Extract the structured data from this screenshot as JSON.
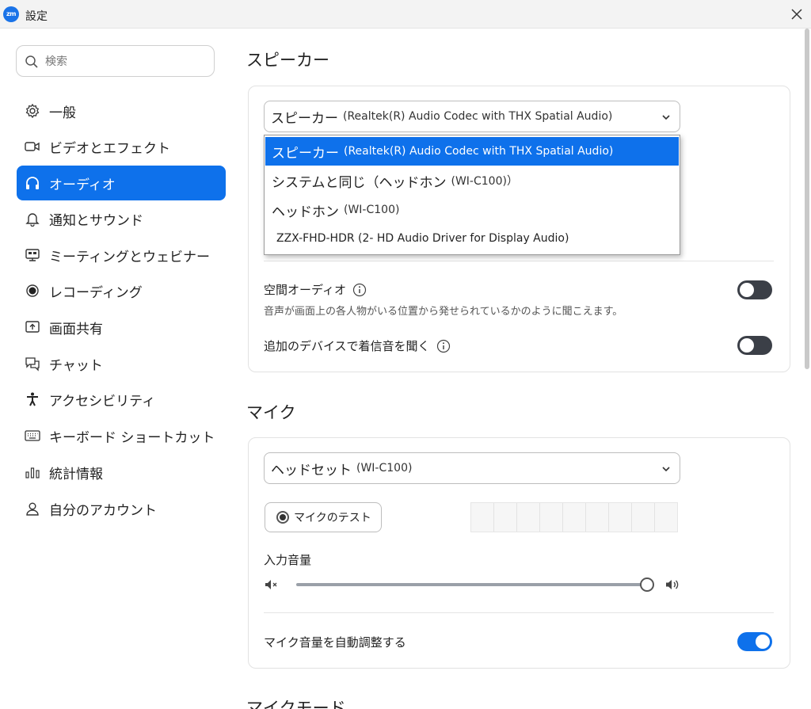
{
  "window": {
    "title": "設定",
    "logo_text": "zm"
  },
  "sidebar": {
    "search_placeholder": "検索",
    "items": [
      {
        "label": "一般",
        "icon": "gear-icon"
      },
      {
        "label": "ビデオとエフェクト",
        "icon": "video-camera-icon"
      },
      {
        "label": "オーディオ",
        "icon": "headphones-icon",
        "active": true
      },
      {
        "label": "通知とサウンド",
        "icon": "bell-icon"
      },
      {
        "label": "ミーティングとウェビナー",
        "icon": "meeting-screen-icon"
      },
      {
        "label": "レコーディング",
        "icon": "record-icon"
      },
      {
        "label": "画面共有",
        "icon": "share-screen-icon"
      },
      {
        "label": "チャット",
        "icon": "chat-icon"
      },
      {
        "label": "アクセシビリティ",
        "icon": "accessibility-icon"
      },
      {
        "label": "キーボード ショートカット",
        "icon": "keyboard-icon"
      },
      {
        "label": "統計情報",
        "icon": "stats-chart-icon"
      },
      {
        "label": "自分のアカウント",
        "icon": "user-icon"
      }
    ]
  },
  "speaker": {
    "section_title": "スピーカー",
    "selected_main": "スピーカー",
    "selected_sub": "(Realtek(R) Audio Codec with THX Spatial Audio)",
    "options": [
      {
        "main": "スピーカー",
        "sub": "(Realtek(R) Audio Codec with THX Spatial Audio)",
        "selected": true
      },
      {
        "main": "システムと同じ（ヘッドホン",
        "sub": "(WI-C100)）"
      },
      {
        "main": "ヘッドホン",
        "sub": "(WI-C100)"
      },
      {
        "main": "ZZX-FHD-HDR (2- HD Audio Driver for Display Audio)",
        "sub": ""
      }
    ],
    "spatial_label": "空間オーディオ",
    "spatial_desc": "音声が画面上の各人物がいる位置から発せられているかのように聞こえます。",
    "spatial_enabled": false,
    "ring_label": "追加のデバイスで着信音を聞く",
    "ring_enabled": false
  },
  "mic": {
    "section_title": "マイク",
    "selected_main": "ヘッドセット",
    "selected_sub": "(WI-C100)",
    "test_button": "マイクのテスト",
    "input_volume_label": "入力音量",
    "input_volume": 0.99,
    "auto_adjust_label": "マイク音量を自動調整する",
    "auto_adjust_enabled": true
  },
  "next_section_title": "マイクモード",
  "colors": {
    "accent": "#0e71eb",
    "toggle_off": "#3b3f47"
  }
}
